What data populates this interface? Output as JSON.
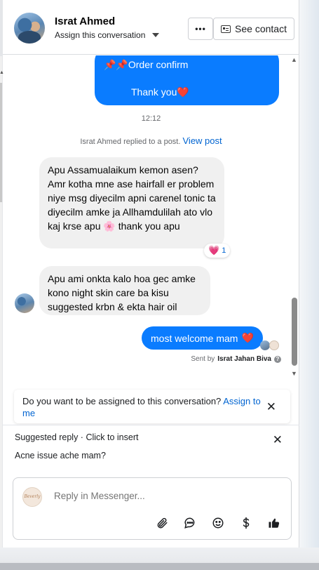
{
  "header": {
    "contact_name": "Israt Ahmed",
    "assign_label": "Assign this conversation",
    "more_label": "•••",
    "see_contact_label": "See contact"
  },
  "messages": {
    "top_outgoing_line1": "📌📌Order confirm",
    "top_outgoing_line2": "Thank you",
    "top_outgoing_emoji": "❤️",
    "timestamp": "12:12",
    "replied_text": "Israt Ahmed replied to a post.",
    "view_post_link": "View post",
    "incoming_1": "Apu Assamualaikum kemon asen? Amr kotha mne ase hairfall er problem niye msg diyecilm apni carenel tonic ta diyecilm amke ja Allhamdulilah ato vlo kaj krse apu 🌸 thank you apu",
    "reaction_emoji": "💗",
    "reaction_count": "1",
    "incoming_2": "Apu ami onkta kalo hoa gec amke kono night skin care ba kisu suggested krbn & ekta hair oil",
    "outgoing_reply": "most welcome mam",
    "outgoing_reply_emoji": "❤️",
    "sent_by_prefix": "Sent by",
    "sent_by_name": "Israt Jahan Biva",
    "help_icon_glyph": "?"
  },
  "assign_banner": {
    "question": "Do you want to be assigned to this conversation?",
    "link": "Assign to me",
    "close_glyph": "✕"
  },
  "suggested_reply": {
    "title": "Suggested reply · Click to insert",
    "text": "Acne issue ache mam?",
    "close_glyph": "✕"
  },
  "composer": {
    "placeholder": "Reply in Messenger...",
    "page_avatar_text": "Beverly",
    "tools": [
      "attachment-icon",
      "saved-reply-icon",
      "emoji-icon",
      "payment-icon",
      "like-icon"
    ]
  },
  "colors": {
    "accent": "#0a7cff",
    "link": "#0064d1",
    "incoming_bubble": "#f0f0f0"
  }
}
